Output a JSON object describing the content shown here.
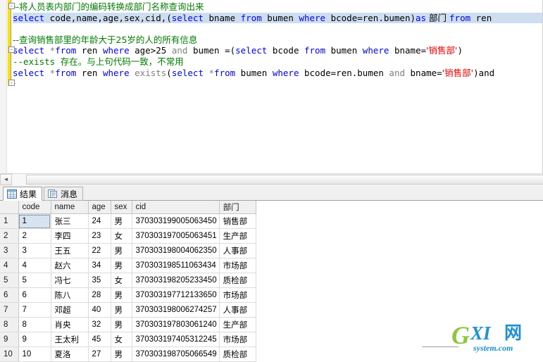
{
  "editor": {
    "lines": [
      {
        "n": 1,
        "selected": false,
        "tokens": [
          {
            "t": "--将人员表内部门的编码转换成部门名称查询出来",
            "c": "cmt"
          }
        ]
      },
      {
        "n": 2,
        "selected": true,
        "tokens": [
          {
            "t": "select",
            "c": "kw"
          },
          {
            "t": " code,name,age,sex,cid,(",
            "c": "id"
          },
          {
            "t": "select",
            "c": "kw"
          },
          {
            "t": " bname ",
            "c": "id"
          },
          {
            "t": "from",
            "c": "kw"
          },
          {
            "t": " bumen ",
            "c": "id"
          },
          {
            "t": "where",
            "c": "kw"
          },
          {
            "t": " bcode=ren.bumen)",
            "c": "id"
          },
          {
            "t": "as",
            "c": "kw"
          },
          {
            "t": " 部门 ",
            "c": "id"
          },
          {
            "t": "from",
            "c": "kw"
          },
          {
            "t": " ren",
            "c": "id"
          }
        ]
      },
      {
        "n": 3,
        "selected": false,
        "tokens": []
      },
      {
        "n": 4,
        "selected": false,
        "tokens": [
          {
            "t": "--查询销售部里的年龄大于25岁的人的所有信息",
            "c": "cmt"
          }
        ]
      },
      {
        "n": 5,
        "selected": false,
        "tokens": [
          {
            "t": "select",
            "c": "kw"
          },
          {
            "t": " *",
            "c": "gray"
          },
          {
            "t": "from",
            "c": "kw"
          },
          {
            "t": " ren ",
            "c": "id"
          },
          {
            "t": "where",
            "c": "kw"
          },
          {
            "t": " age>",
            "c": "id"
          },
          {
            "t": "25",
            "c": "num"
          },
          {
            "t": " and",
            "c": "gray"
          },
          {
            "t": " bumen =(",
            "c": "id"
          },
          {
            "t": "select",
            "c": "kw"
          },
          {
            "t": " bcode ",
            "c": "id"
          },
          {
            "t": "from",
            "c": "kw"
          },
          {
            "t": " bumen ",
            "c": "id"
          },
          {
            "t": "where",
            "c": "kw"
          },
          {
            "t": " bname=",
            "c": "id"
          },
          {
            "t": "'销售部'",
            "c": "str"
          },
          {
            "t": ")",
            "c": "id"
          }
        ]
      },
      {
        "n": 6,
        "selected": false,
        "tokens": [
          {
            "t": "--exists ",
            "c": "cmt"
          },
          {
            "t": "存在。与上句代码一致，不常用",
            "c": "cmt"
          }
        ]
      },
      {
        "n": 7,
        "selected": false,
        "tokens": [
          {
            "t": "select",
            "c": "kw"
          },
          {
            "t": " *",
            "c": "gray"
          },
          {
            "t": "from",
            "c": "kw"
          },
          {
            "t": " ren ",
            "c": "id"
          },
          {
            "t": "where",
            "c": "kw"
          },
          {
            "t": " ",
            "c": "id"
          },
          {
            "t": "exists",
            "c": "gray"
          },
          {
            "t": "(",
            "c": "id"
          },
          {
            "t": "select",
            "c": "kw"
          },
          {
            "t": " *",
            "c": "gray"
          },
          {
            "t": "from",
            "c": "kw"
          },
          {
            "t": " bumen ",
            "c": "id"
          },
          {
            "t": "where",
            "c": "kw"
          },
          {
            "t": " bcode=ren.bumen ",
            "c": "id"
          },
          {
            "t": "and",
            "c": "gray"
          },
          {
            "t": " bname=",
            "c": "id"
          },
          {
            "t": "'销售部'",
            "c": "str"
          },
          {
            "t": ")and",
            "c": "id"
          }
        ]
      }
    ],
    "colors": {
      "comment": "#008000",
      "keyword": "#0000ff",
      "string": "#ff0000",
      "selection": "#cddef0",
      "change_bar": "#ffe200"
    }
  },
  "hscroll": {
    "left_arrow": "◄",
    "grip": "⋮⋮"
  },
  "tabs": [
    {
      "label": "结果",
      "icon": "grid-icon",
      "active": true
    },
    {
      "label": "消息",
      "icon": "message-icon",
      "active": false
    }
  ],
  "results": {
    "columns": [
      "",
      "code",
      "name",
      "age",
      "sex",
      "cid",
      "部门"
    ],
    "rows": [
      {
        "n": "1",
        "code": "1",
        "name": "张三",
        "age": "24",
        "sex": "男",
        "cid": "370303199005063450",
        "dept": "销售部"
      },
      {
        "n": "2",
        "code": "2",
        "name": "李四",
        "age": "23",
        "sex": "女",
        "cid": "370303197005063451",
        "dept": "生产部"
      },
      {
        "n": "3",
        "code": "3",
        "name": "王五",
        "age": "22",
        "sex": "男",
        "cid": "370303198004062350",
        "dept": "人事部"
      },
      {
        "n": "4",
        "code": "4",
        "name": "赵六",
        "age": "34",
        "sex": "男",
        "cid": "370303198511063434",
        "dept": "市场部"
      },
      {
        "n": "5",
        "code": "5",
        "name": "冯七",
        "age": "35",
        "sex": "女",
        "cid": "370303198205233450",
        "dept": "质检部"
      },
      {
        "n": "6",
        "code": "6",
        "name": "陈八",
        "age": "28",
        "sex": "男",
        "cid": "370303197712133650",
        "dept": "市场部"
      },
      {
        "n": "7",
        "code": "7",
        "name": "邓超",
        "age": "40",
        "sex": "男",
        "cid": "370303198006274257",
        "dept": "人事部"
      },
      {
        "n": "8",
        "code": "8",
        "name": "肖央",
        "age": "32",
        "sex": "男",
        "cid": "370303197803061240",
        "dept": "生产部"
      },
      {
        "n": "9",
        "code": "9",
        "name": "王太利",
        "age": "45",
        "sex": "女",
        "cid": "370303197405312245",
        "dept": "市场部"
      },
      {
        "n": "10",
        "code": "10",
        "name": "夏洛",
        "age": "27",
        "sex": "男",
        "cid": "370303198705066549",
        "dept": "质检部"
      }
    ],
    "selected_cell": {
      "row": 1,
      "column": "code"
    }
  },
  "watermark": {
    "g": "G",
    "xi": "XI",
    "net": "网",
    "sub": "system.com"
  }
}
